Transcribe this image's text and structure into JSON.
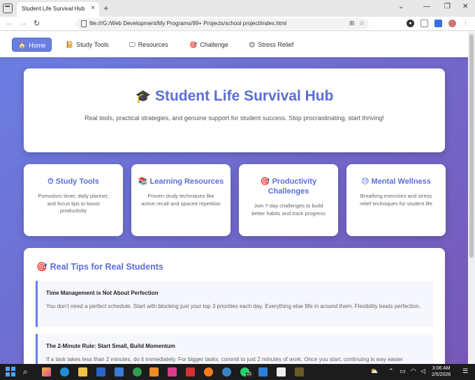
{
  "browser": {
    "tab_title": "Student Life Survival Hub",
    "tab_close": "×",
    "new_tab": "+",
    "url": "file:///G:/Web Development/My Programs/99+ Projects/school project/index.html",
    "back": "←",
    "forward": "→",
    "reload": "↻",
    "window_controls": [
      "—",
      "❐",
      "✕"
    ]
  },
  "nav": {
    "items": [
      {
        "icon": "🏠",
        "label": "Home",
        "active": true
      },
      {
        "icon": "📔",
        "label": "Study Tools"
      },
      {
        "icon": "🖵",
        "label": "Resources"
      },
      {
        "icon": "🎯",
        "label": "Challenge"
      },
      {
        "icon": "😌",
        "label": "Stress Relief"
      }
    ]
  },
  "hero": {
    "icon": "🎓",
    "title": "Student Life Survival Hub",
    "subtitle": "Real tools, practical strategies, and genuine support for student success. Stop procrastinating, start thriving!"
  },
  "features": [
    {
      "icon": "⏱",
      "title": "Study Tools",
      "desc": "Pomodoro timer, daily planner, and focus tips to boost productivity"
    },
    {
      "icon": "📚",
      "title": "Learning Resources",
      "desc": "Proven study techniques like active recall and spaced repetition"
    },
    {
      "icon": "🎯",
      "title": "Productivity Challenges",
      "desc": "Join 7-day challenges to build better habits and track progress"
    },
    {
      "icon": "😓",
      "title": "Mental Wellness",
      "desc": "Breathing exercises and stress relief techniques for student life"
    }
  ],
  "tips": {
    "icon": "🎯",
    "title": "Real Tips for Real Students",
    "items": [
      {
        "title": "Time Management is Not About Perfection",
        "body": "You don't need a perfect schedule. Start with blocking just your top 3 priorities each day. Everything else fills in around them. Flexibility beats perfection."
      },
      {
        "title": "The 2-Minute Rule: Start Small, Build Momentum",
        "body": "If a task takes less than 2 minutes, do it immediately. For bigger tasks, commit to just 2 minutes of work. Once you start, continuing is way easier"
      }
    ]
  },
  "taskbar": {
    "time": "3:06 AM",
    "date": "2/5/2026",
    "badge": "22"
  },
  "colors": {
    "accent": "#5b6ed8",
    "gradient_start": "#6a7ee3",
    "gradient_end": "#7758b8"
  }
}
